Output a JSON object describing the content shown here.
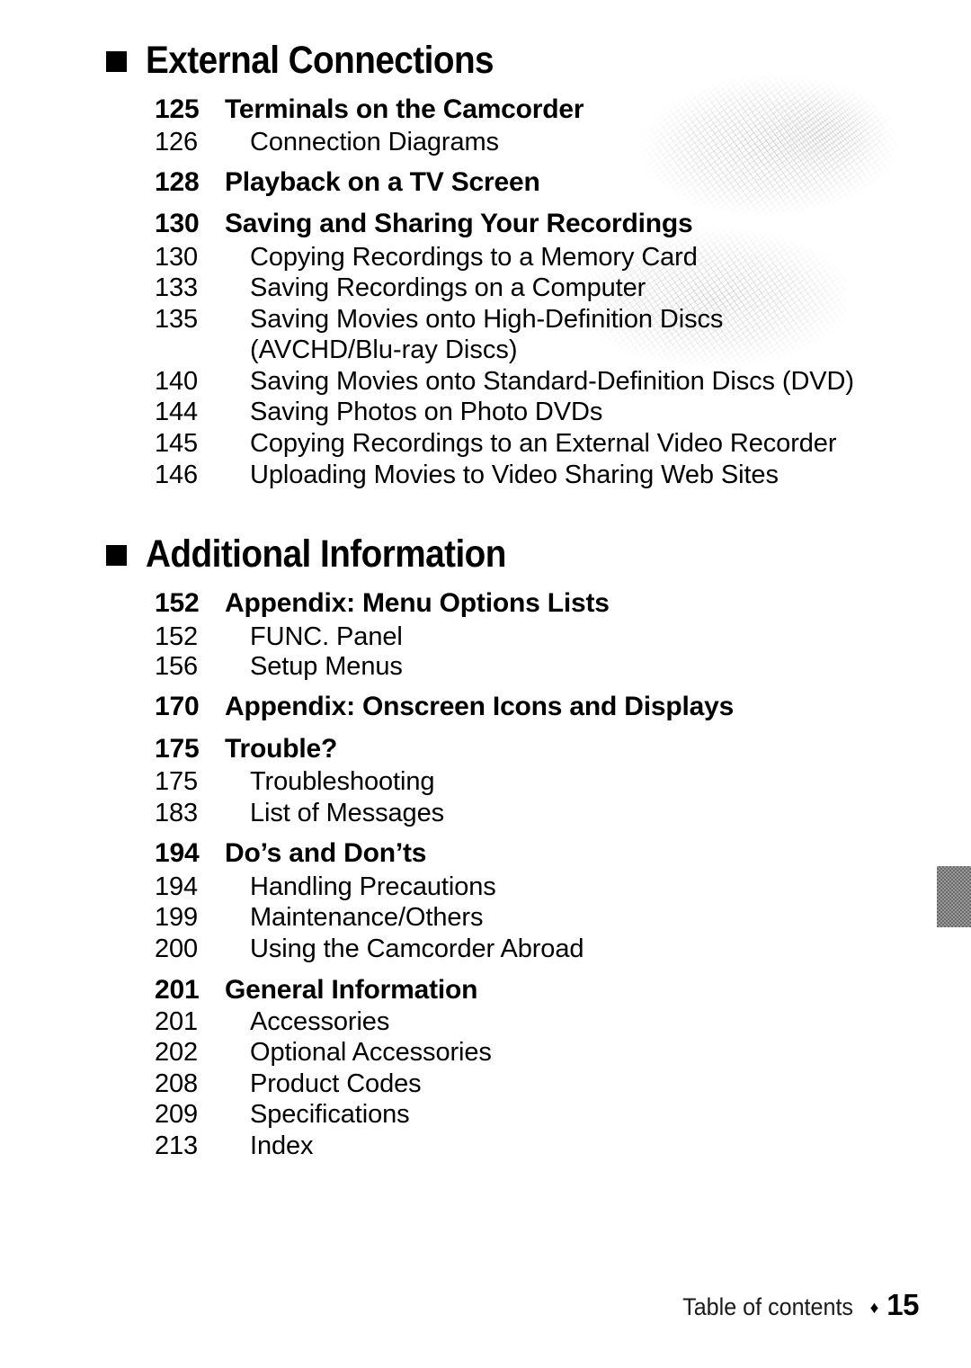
{
  "page": {
    "footer_label": "Table of contents",
    "footer_separator": "♦",
    "footer_page_number": "15"
  },
  "sections": [
    {
      "heading": "External Connections",
      "bullet_icon": "black-square-bullet",
      "entries": [
        {
          "page": "125",
          "title": "Terminals on the Camcorder",
          "level": "major"
        },
        {
          "page": "126",
          "title": "Connection Diagrams",
          "level": "minor"
        },
        {
          "page": "128",
          "title": "Playback on a TV Screen",
          "level": "major"
        },
        {
          "page": "130",
          "title": "Saving and Sharing Your Recordings",
          "level": "major"
        },
        {
          "page": "130",
          "title": "Copying Recordings to a Memory Card",
          "level": "minor"
        },
        {
          "page": "133",
          "title": "Saving Recordings on a Computer",
          "level": "minor"
        },
        {
          "page": "135",
          "title": "Saving Movies onto High-Definition Discs",
          "level": "minor"
        },
        {
          "page": "",
          "title": "(AVCHD/Blu-ray Discs)",
          "level": "continuation"
        },
        {
          "page": "140",
          "title": "Saving Movies onto Standard-Definition Discs (DVD)",
          "level": "minor"
        },
        {
          "page": "144",
          "title": "Saving Photos on Photo DVDs",
          "level": "minor"
        },
        {
          "page": "145",
          "title": "Copying Recordings to an External Video Recorder",
          "level": "minor"
        },
        {
          "page": "146",
          "title": "Uploading Movies to Video Sharing Web Sites",
          "level": "minor"
        }
      ]
    },
    {
      "heading": "Additional Information",
      "bullet_icon": "black-square-bullet",
      "entries": [
        {
          "page": "152",
          "title": "Appendix: Menu Options Lists",
          "level": "major"
        },
        {
          "page": "152",
          "title": "FUNC. Panel",
          "level": "minor"
        },
        {
          "page": "156",
          "title": "Setup Menus",
          "level": "minor"
        },
        {
          "page": "170",
          "title": "Appendix: Onscreen Icons and Displays",
          "level": "major"
        },
        {
          "page": "175",
          "title": "Trouble?",
          "level": "major"
        },
        {
          "page": "175",
          "title": "Troubleshooting",
          "level": "minor"
        },
        {
          "page": "183",
          "title": "List of Messages",
          "level": "minor"
        },
        {
          "page": "194",
          "title": "Do’s and Don’ts",
          "level": "major"
        },
        {
          "page": "194",
          "title": "Handling Precautions",
          "level": "minor"
        },
        {
          "page": "199",
          "title": "Maintenance/Others",
          "level": "minor"
        },
        {
          "page": "200",
          "title": "Using the Camcorder Abroad",
          "level": "minor"
        },
        {
          "page": "201",
          "title": "General Information",
          "level": "major"
        },
        {
          "page": "201",
          "title": "Accessories",
          "level": "minor"
        },
        {
          "page": "202",
          "title": "Optional Accessories",
          "level": "minor"
        },
        {
          "page": "208",
          "title": "Product Codes",
          "level": "minor"
        },
        {
          "page": "209",
          "title": "Specifications",
          "level": "minor"
        },
        {
          "page": "213",
          "title": "Index",
          "level": "minor"
        }
      ]
    }
  ],
  "layout": {
    "section_tops": [
      46,
      595
    ],
    "row_tops": [
      [
        105,
        141,
        186,
        232,
        269,
        303,
        338,
        372,
        407,
        441,
        476,
        511
      ],
      [
        654,
        691,
        724,
        769,
        816,
        852,
        887,
        932,
        969,
        1003,
        1038,
        1084,
        1119,
        1153,
        1188,
        1222,
        1257
      ]
    ]
  }
}
